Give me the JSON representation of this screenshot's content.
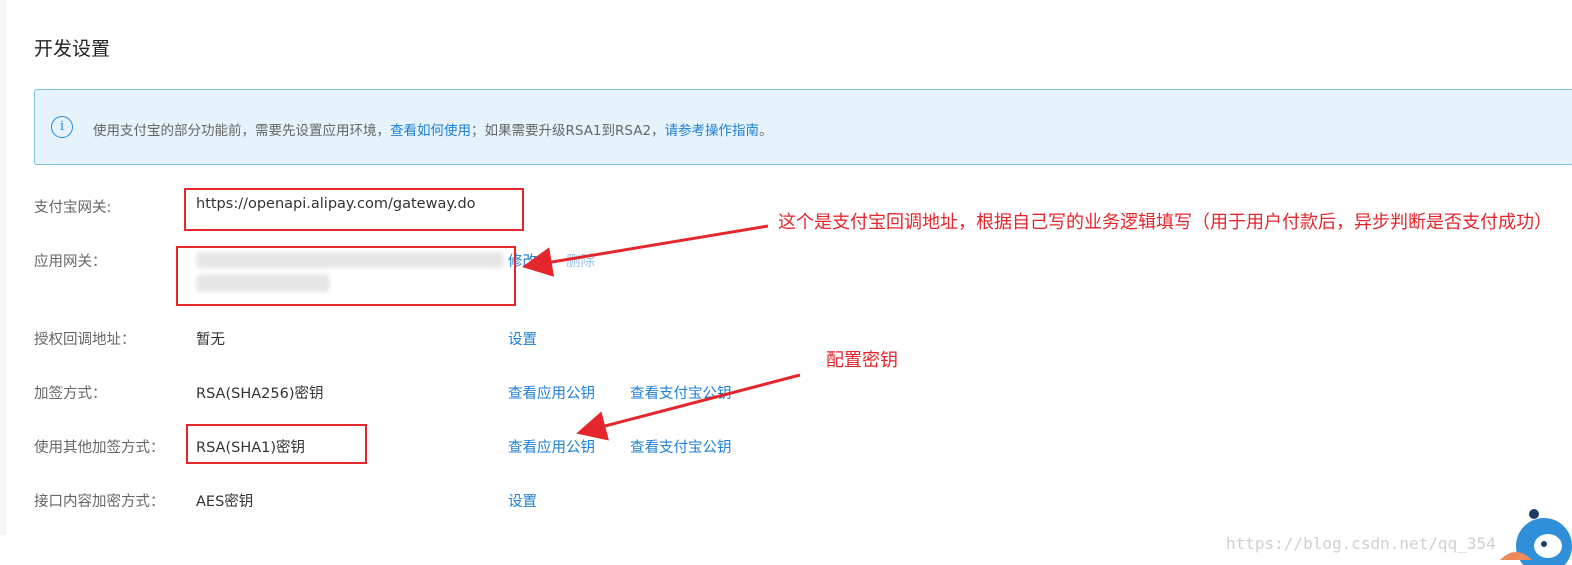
{
  "page": {
    "title": "开发设置"
  },
  "banner": {
    "icon": "info-icon",
    "text_before": "使用支付宝的部分功能前，需要先设置应用环境，",
    "link1": "查看如何使用",
    "text_middle": "；如果需要升级RSA1到RSA2，",
    "link2": "请参考操作指南",
    "text_after": "。"
  },
  "rows": {
    "gateway": {
      "label": "支付宝网关:",
      "value": "https://openapi.alipay.com/gateway.do"
    },
    "app_gateway": {
      "label": "应用网关：",
      "edit": "修改",
      "delete": "删除"
    },
    "auth_callback": {
      "label": "授权回调地址：",
      "value": "暂无",
      "action": "设置"
    },
    "sign_method": {
      "label": "加签方式：",
      "value": "RSA(SHA256)密钥",
      "action1": "查看应用公钥",
      "action2": "查看支付宝公钥"
    },
    "other_sign": {
      "label": "使用其他加签方式：",
      "value": "RSA(SHA1)密钥",
      "action1": "查看应用公钥",
      "action2": "查看支付宝公钥"
    },
    "content_encrypt": {
      "label": "接口内容加密方式：",
      "value": "AES密钥",
      "action": "设置"
    }
  },
  "annotations": {
    "callback_note": "这个是支付宝回调地址，根据自己写的业务逻辑填写（用于用户付款后，异步判断是否支付成功）",
    "key_note": "配置密钥"
  },
  "watermark": "https://blog.csdn.net/qq_354",
  "colors": {
    "link": "#1d7fd6",
    "annotation": "#e5262c",
    "banner_bg": "#e6f3fc",
    "banner_border": "#7fc0ec"
  }
}
